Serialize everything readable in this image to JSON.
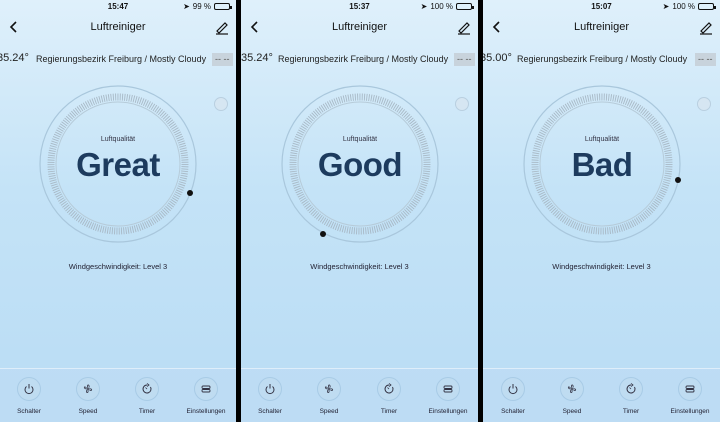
{
  "screens": [
    {
      "time": "15:47",
      "battery": "99 %",
      "battery_level": 0.99,
      "title": "Luftreiniger",
      "temp": "35.24°",
      "location": "Regierungsbezirk Freiburg / Mostly Cloudy",
      "dash": "-- --",
      "quality_label": "Luftqualität",
      "quality": "Great",
      "wind": "Windgeschwindigkeit: Level 3",
      "indicator_angle_deg": 80
    },
    {
      "time": "15:37",
      "battery": "100 %",
      "battery_level": 1.0,
      "title": "Luftreiniger",
      "temp": "35.24°",
      "location": "Regierungsbezirk Freiburg / Mostly Cloudy",
      "dash": "-- --",
      "quality_label": "Luftqualität",
      "quality": "Good",
      "wind": "Windgeschwindigkeit: Level 3",
      "indicator_angle_deg": 152
    },
    {
      "time": "15:07",
      "battery": "100 %",
      "battery_level": 1.0,
      "title": "Luftreiniger",
      "temp": "35.00°",
      "location": "Regierungsbezirk Freiburg / Mostly Cloudy",
      "dash": "-- --",
      "quality_label": "Luftqualität",
      "quality": "Bad",
      "wind": "Windgeschwindigkeit: Level 3",
      "indicator_angle_deg": 85
    }
  ],
  "tabs": [
    {
      "label": "Schalter",
      "icon": "power-icon"
    },
    {
      "label": "Speed",
      "icon": "fan-icon"
    },
    {
      "label": "Timer",
      "icon": "timer-icon"
    },
    {
      "label": "Einstellungen",
      "icon": "settings-icon"
    }
  ],
  "colors": {
    "quality_text": "#1d3b5e",
    "background_top": "#dff0fb",
    "background_bottom": "#b9dcf4"
  }
}
